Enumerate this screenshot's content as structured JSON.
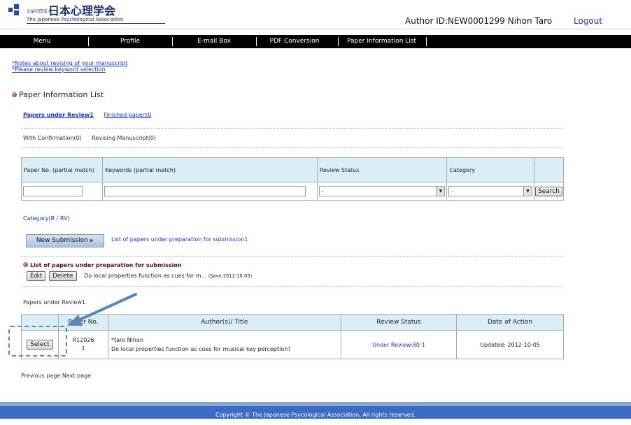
{
  "header": {
    "org_prefix": "公益社団法人",
    "org_name": "日本心理学会",
    "org_en": "The Japanese Psychological Association",
    "author_text": "Author  ID:NEW0001299 Nihon Taro",
    "logout": "Logout"
  },
  "nav": [
    "Menu",
    "Profile",
    "E-mail Box",
    "PDF Conversion",
    "Paper Information List"
  ],
  "notes": [
    "*Notes about revising of your manuscript",
    "*Please review keyword selection"
  ],
  "section_title": "Paper Information List",
  "tabs": {
    "active": "Papers under Review1",
    "inactive": "Finished papers0"
  },
  "confirm": {
    "with_confirmation": "With Confirmation(0)",
    "revising": "Revising Manuscript(0)"
  },
  "search": {
    "headers": [
      "Paper No. (partial match)",
      "Keywords (partial match)",
      "Review Status",
      "Category"
    ],
    "review_status_value": "-",
    "category_value": "-",
    "search_button": "Search"
  },
  "category_label": "Category(R / RV)",
  "new_submission": "New Submission",
  "prep_link": "List of papers under preparation for submission1",
  "prep": {
    "title": "List of papers under preparation for submission",
    "edit": "Edit",
    "delete": "Delete",
    "text": "Do local properties function as cues for m...",
    "save": "(Save:2012-10-05)"
  },
  "papers_label": "Papers under Review1",
  "paper_table": {
    "headers": [
      "",
      "Paper No.",
      "Author(s)/ Title",
      "Review Status",
      "Date of Action"
    ],
    "rows": [
      {
        "select": "Select",
        "paper_no_1": "R12026",
        "paper_no_2": "1",
        "author": "*taro Nihon",
        "title": "Do local properties function as cues for musical key perception?",
        "status": "Under Review:80-1",
        "date": "Updated: 2012-10-05"
      }
    ]
  },
  "pagination": "Previous page Next page",
  "footer": "Copyright © The Japanese Psycological Association, All rights reserved.",
  "colors": {
    "nav_bg": "#000000",
    "table_header": "#d9eef5",
    "footer": "#3c6bc4",
    "link": "#1a33cc",
    "annotation": "#5b86b8"
  }
}
